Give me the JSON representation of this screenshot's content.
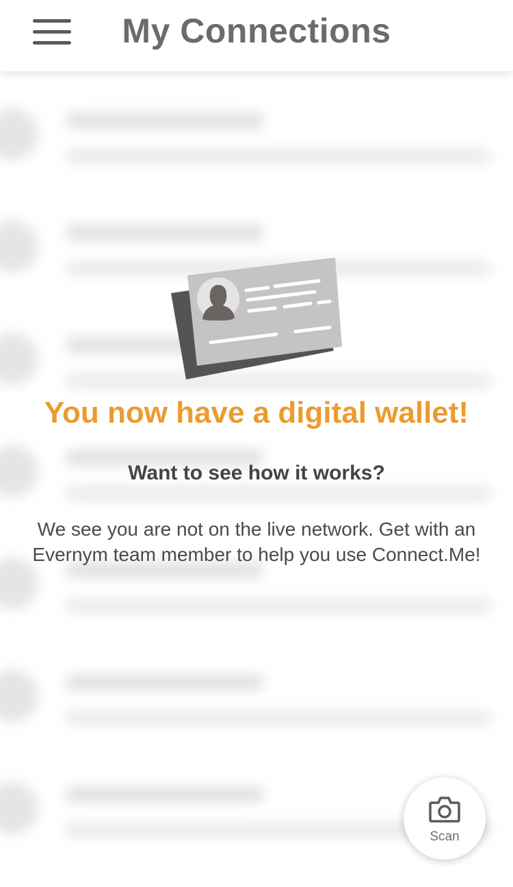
{
  "header": {
    "title": "My Connections",
    "menu_icon": "hamburger-menu-icon"
  },
  "empty_state": {
    "illustration": "id-card-icon",
    "headline": "You now have a digital wallet!",
    "subheadline": "Want to see how it works?",
    "message": "We see you are not on the live network. Get with an Evernym team member to help you use Connect.Me!"
  },
  "scan_button": {
    "label": "Scan",
    "icon": "camera-icon"
  },
  "colors": {
    "accent": "#eb9b2f",
    "title_text": "#6b6b6b",
    "body_text": "#4a4a4a",
    "card_front": "#c4c4c4",
    "card_back": "#545454"
  }
}
